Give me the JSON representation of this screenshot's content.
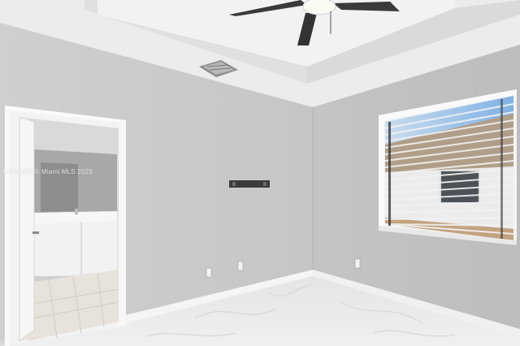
{
  "photo": {
    "watermark": "A1231585 © Miami MLS 2025"
  },
  "colors": {
    "wall_left": "#c9c9c9",
    "wall_right": "#c2c2c2",
    "ceiling": "#eeeeee",
    "tray": "#e3e3e3",
    "trim": "#f3f3f3",
    "floor": "#e9e9eb",
    "bath_cabinet": "#f4f4f4"
  }
}
